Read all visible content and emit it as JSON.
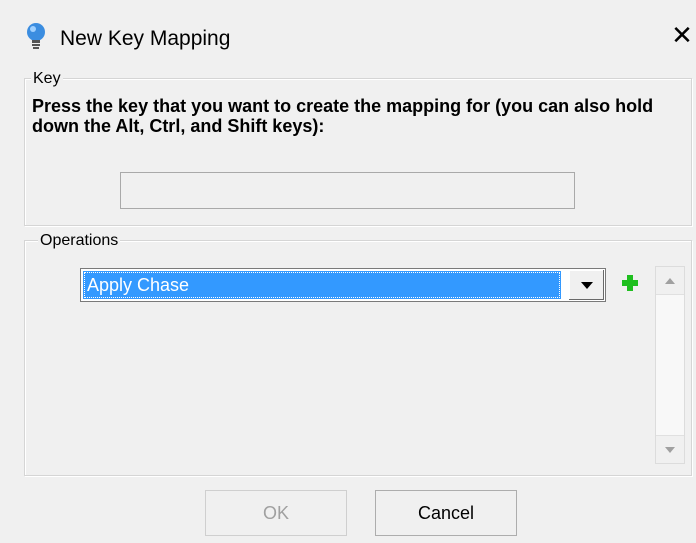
{
  "window": {
    "title": "New Key Mapping",
    "close_label": "✕"
  },
  "key_group": {
    "label": "Key",
    "instruction": "Press the key that you want to create the mapping for (you can also hold down the Alt, Ctrl, and Shift keys):",
    "input_value": ""
  },
  "operations_group": {
    "label": "Operations",
    "selected_operation": "Apply Chase",
    "add_icon": "plus-icon",
    "accent_color": "#3399ff",
    "add_color": "#1fbf1f"
  },
  "buttons": {
    "ok": "OK",
    "cancel": "Cancel"
  }
}
